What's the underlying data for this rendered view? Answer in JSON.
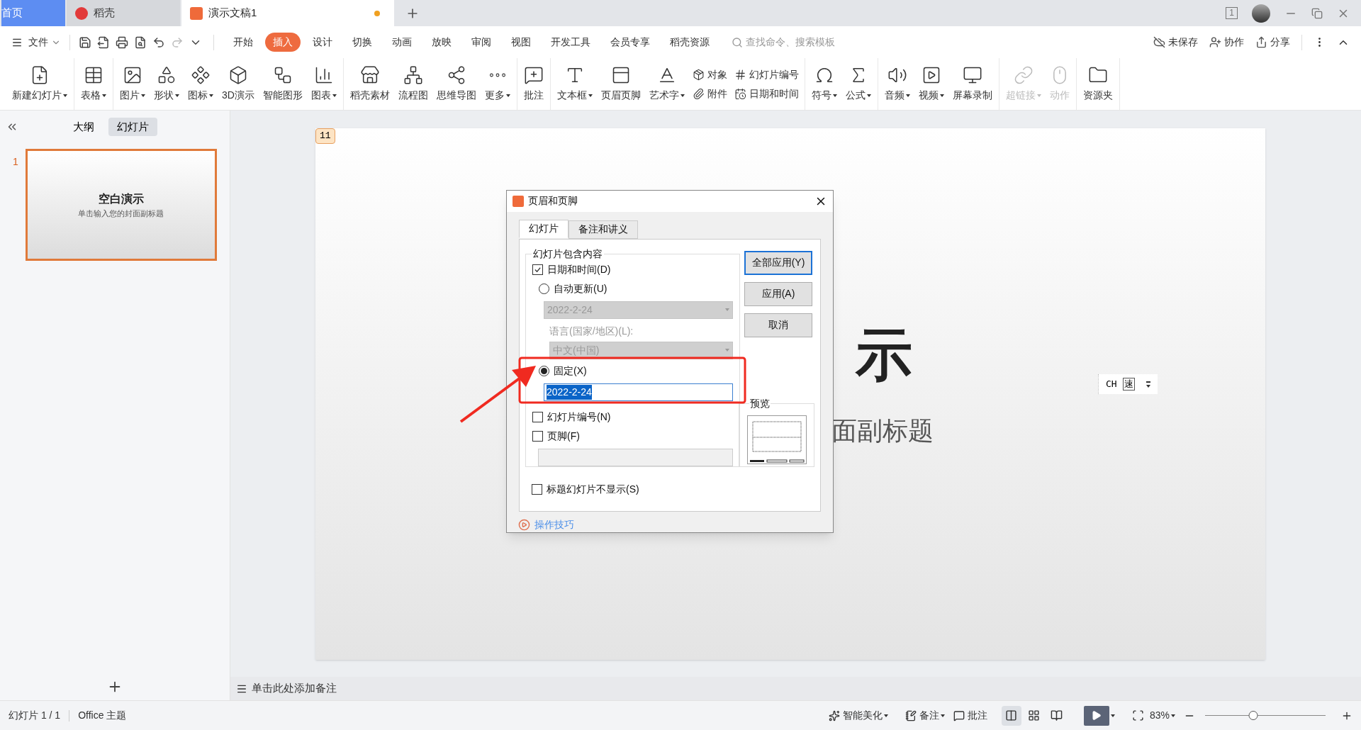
{
  "tab_bar": {
    "tabs": [
      {
        "label": "首页",
        "kind": "home",
        "selected": false
      },
      {
        "label": "稻壳",
        "kind": "docer",
        "selected": false
      },
      {
        "label": "演示文稿1",
        "kind": "doc",
        "selected": true,
        "modified": true
      }
    ],
    "window_count": "1"
  },
  "menu": {
    "file": "文件",
    "tabs": [
      {
        "label": "开始",
        "selected": false
      },
      {
        "label": "插入",
        "selected": true
      },
      {
        "label": "设计",
        "selected": false
      },
      {
        "label": "切换",
        "selected": false
      },
      {
        "label": "动画",
        "selected": false
      },
      {
        "label": "放映",
        "selected": false
      },
      {
        "label": "审阅",
        "selected": false
      },
      {
        "label": "视图",
        "selected": false
      },
      {
        "label": "开发工具",
        "selected": false
      },
      {
        "label": "会员专享",
        "selected": false
      },
      {
        "label": "稻壳资源",
        "selected": false
      }
    ],
    "search": {
      "placeholder": "查找命令、搜索模板"
    },
    "actions": [
      "未保存",
      "协作",
      "分享"
    ]
  },
  "ribbon": {
    "groups": [
      [
        {
          "kind": "large",
          "label": "新建幻灯片",
          "dropdown": true,
          "disabled": false
        }
      ],
      [
        {
          "kind": "large",
          "label": "表格",
          "dropdown": true,
          "disabled": false
        }
      ],
      [
        {
          "kind": "large",
          "label": "图片",
          "dropdown": true,
          "disabled": false
        },
        {
          "kind": "large",
          "label": "形状",
          "dropdown": true,
          "disabled": false
        },
        {
          "kind": "large",
          "label": "图标",
          "dropdown": true,
          "disabled": false
        },
        {
          "kind": "large",
          "label": "3D演示",
          "dropdown": false,
          "disabled": false
        },
        {
          "kind": "large",
          "label": "智能图形",
          "dropdown": false,
          "disabled": false
        },
        {
          "kind": "large",
          "label": "图表",
          "dropdown": true,
          "disabled": false
        }
      ],
      [
        {
          "kind": "large",
          "label": "稻壳素材",
          "dropdown": false,
          "disabled": false
        },
        {
          "kind": "large",
          "label": "流程图",
          "dropdown": false,
          "disabled": false
        },
        {
          "kind": "large",
          "label": "思维导图",
          "dropdown": false,
          "disabled": false
        },
        {
          "kind": "large",
          "label": "更多",
          "dropdown": true,
          "disabled": false
        }
      ],
      [
        {
          "kind": "large",
          "label": "批注",
          "dropdown": false,
          "disabled": false
        }
      ],
      [
        {
          "kind": "large",
          "label": "文本框",
          "dropdown": true,
          "disabled": false
        },
        {
          "kind": "large",
          "label": "页眉页脚",
          "dropdown": false,
          "disabled": false
        },
        {
          "kind": "large",
          "label": "艺术字",
          "dropdown": true,
          "disabled": false
        },
        {
          "kind": "stack",
          "items": [
            "对象",
            "附件"
          ]
        },
        {
          "kind": "stack",
          "items": [
            "幻灯片编号",
            "日期和时间"
          ]
        }
      ],
      [
        {
          "kind": "large",
          "label": "符号",
          "dropdown": true,
          "disabled": false
        },
        {
          "kind": "large",
          "label": "公式",
          "dropdown": true,
          "disabled": false
        }
      ],
      [
        {
          "kind": "large",
          "label": "音频",
          "dropdown": true,
          "disabled": false
        },
        {
          "kind": "large",
          "label": "视频",
          "dropdown": true,
          "disabled": false
        },
        {
          "kind": "large",
          "label": "屏幕录制",
          "dropdown": false,
          "disabled": false
        }
      ],
      [
        {
          "kind": "large",
          "label": "超链接",
          "dropdown": true,
          "disabled": true
        },
        {
          "kind": "large",
          "label": "动作",
          "dropdown": false,
          "disabled": true
        }
      ],
      [
        {
          "kind": "large",
          "label": "资源夹",
          "dropdown": false,
          "disabled": false
        }
      ]
    ]
  },
  "left_panel": {
    "views": [
      {
        "label": "大纲",
        "selected": false
      },
      {
        "label": "幻灯片",
        "selected": true
      }
    ],
    "slides": [
      {
        "number": "1",
        "title": "空白演示",
        "subtitle": "单击输入您的封面副标题",
        "selected": true
      }
    ]
  },
  "slide": {
    "number_tag": "11",
    "title": "示",
    "subtitle": "面副标题"
  },
  "ime_bar": {
    "mode": "CH",
    "speed": "速"
  },
  "notes": {
    "placeholder": "单击此处添加备注"
  },
  "dialog": {
    "title": "页眉和页脚",
    "tabs": [
      {
        "label": "幻灯片",
        "selected": true
      },
      {
        "label": "备注和讲义",
        "selected": false
      }
    ],
    "group_title": "幻灯片包含内容",
    "date_time": {
      "label": "日期和时间(D)",
      "checked": true
    },
    "auto_update": {
      "label": "自动更新(U)",
      "selected": false,
      "value": "2022-2-24"
    },
    "language": {
      "label": "语言(国家/地区)(L):",
      "value": "中文(中国)"
    },
    "fixed": {
      "label": "固定(X)",
      "selected": true,
      "value": "2022-2-24"
    },
    "slide_number": {
      "label": "幻灯片编号(N)",
      "checked": false
    },
    "footer": {
      "label": "页脚(F)",
      "checked": false
    },
    "hide_on_title": {
      "label": "标题幻灯片不显示(S)",
      "checked": false
    },
    "buttons": [
      {
        "label": "全部应用(Y)",
        "default": true
      },
      {
        "label": "应用(A)",
        "default": false
      },
      {
        "label": "取消",
        "default": false
      }
    ],
    "preview": "预览",
    "help": "操作技巧"
  },
  "status_bar": {
    "slide": "幻灯片 1 / 1",
    "theme": "Office 主题",
    "beautify": "智能美化",
    "notes": "备注",
    "comments": "批注",
    "views": [
      {
        "selected": true
      },
      {
        "selected": false
      },
      {
        "selected": false
      }
    ],
    "zoom": "83%",
    "zoom_slider": {
      "level": 0.4
    }
  }
}
